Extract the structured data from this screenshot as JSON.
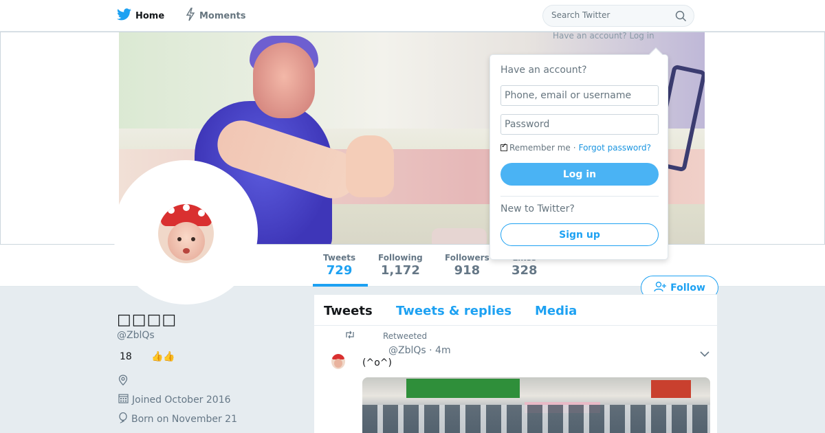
{
  "nav": {
    "home_label": "Home",
    "moments_label": "Moments"
  },
  "search": {
    "placeholder": "Search Twitter"
  },
  "login_cta": {
    "text": "Have an account?",
    "link": "Log in"
  },
  "login_dropdown": {
    "title": "Have an account?",
    "username_placeholder": "Phone, email or username",
    "password_placeholder": "Password",
    "remember_label": "Remember me",
    "separator": "·",
    "forgot_label": "Forgot password?",
    "login_button": "Log in",
    "new_label": "New to Twitter?",
    "signup_button": "Sign up"
  },
  "profile": {
    "name": "□□□□",
    "handle": "@ZblQs",
    "bio_number": "18",
    "bio_emoji": "👍👍",
    "joined": "Joined October 2016",
    "born": "Born on November 21"
  },
  "stats": {
    "tweets_label": "Tweets",
    "tweets_value": "729",
    "following_label": "Following",
    "following_value": "1,172",
    "followers_label": "Followers",
    "followers_value": "918",
    "likes_label": "Likes",
    "likes_value": "328"
  },
  "follow_button": "Follow",
  "timeline": {
    "tabs": [
      {
        "label": "Tweets"
      },
      {
        "label": "Tweets & replies"
      },
      {
        "label": "Media"
      }
    ],
    "tweet": {
      "context": "Retweeted",
      "header": "@ZblQs · 4m",
      "text": "(^o^)"
    }
  },
  "colors": {
    "accent": "#1da1f2",
    "background": "#e6ecf0",
    "login_button": "#4ab3f4"
  }
}
